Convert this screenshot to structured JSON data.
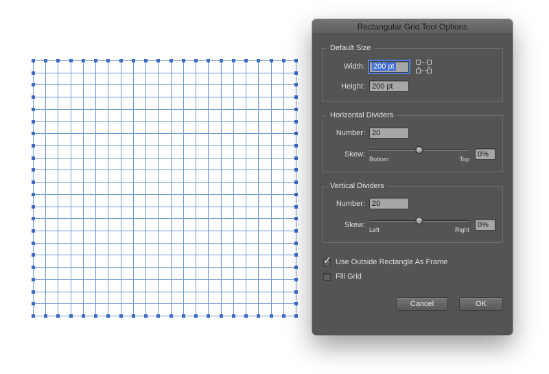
{
  "window": {
    "title": "Rectangular Grid Tool Options"
  },
  "default_size": {
    "legend": "Default Size",
    "width": {
      "label": "Width:",
      "value": "200 pt",
      "selected": true
    },
    "height": {
      "label": "Height:",
      "value": "200 pt",
      "selected": false
    }
  },
  "horizontal_dividers": {
    "legend": "Horizontal Dividers",
    "number": {
      "label": "Number:",
      "value": "20"
    },
    "skew": {
      "label": "Skew:",
      "value": "0%",
      "left_label": "Bottom",
      "right_label": "Top",
      "position_percent": 50
    }
  },
  "vertical_dividers": {
    "legend": "Vertical Dividers",
    "number": {
      "label": "Number:",
      "value": "20"
    },
    "skew": {
      "label": "Skew:",
      "value": "0%",
      "left_label": "Left",
      "right_label": "Right",
      "position_percent": 50
    }
  },
  "options": {
    "checkmark_glyph": "✓",
    "use_outside_rectangle": {
      "label": "Use Outside Rectangle As Frame",
      "checked": true
    },
    "fill_grid": {
      "label": "Fill Grid",
      "checked": false
    }
  },
  "buttons": {
    "cancel": "Cancel",
    "ok": "OK"
  },
  "canvas_grid": {
    "columns": 21,
    "rows": 21,
    "line_color": "#6d96d8",
    "anchor_color": "#3c6cc6"
  }
}
